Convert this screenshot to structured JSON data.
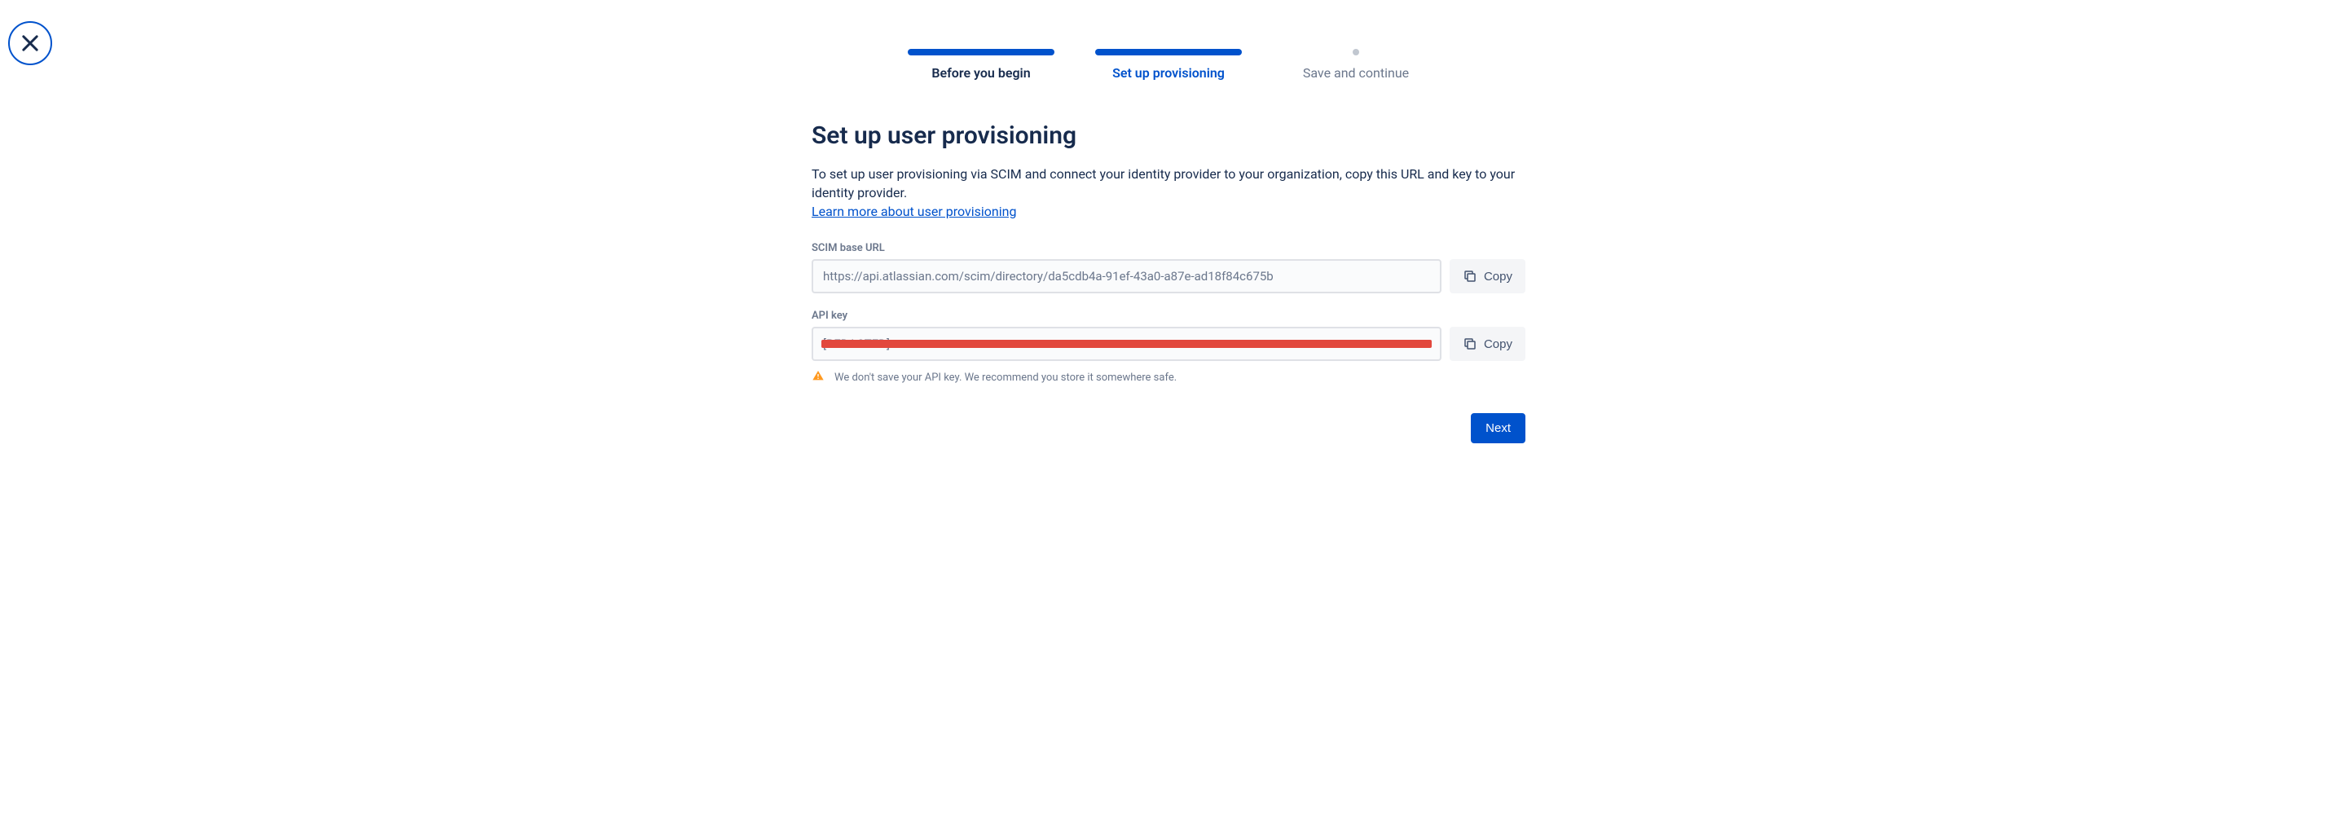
{
  "steps": [
    {
      "label": "Before you begin",
      "state": "done"
    },
    {
      "label": "Set up provisioning",
      "state": "active"
    },
    {
      "label": "Save and continue",
      "state": "future"
    }
  ],
  "page": {
    "title": "Set up user provisioning",
    "description": "To set up user provisioning via SCIM and connect your identity provider to your organization, copy this URL and key to your identity provider.",
    "learn_more": "Learn more about user provisioning"
  },
  "fields": {
    "scim_url": {
      "label": "SCIM base URL",
      "value": "https://api.atlassian.com/scim/directory/da5cdb4a-91ef-43a0-a87e-ad18f84c675b",
      "copy_label": "Copy"
    },
    "api_key": {
      "label": "API key",
      "value": "[REDACTED]",
      "copy_label": "Copy",
      "warning": "We don't save your API key. We recommend you store it somewhere safe."
    }
  },
  "actions": {
    "next": "Next"
  }
}
